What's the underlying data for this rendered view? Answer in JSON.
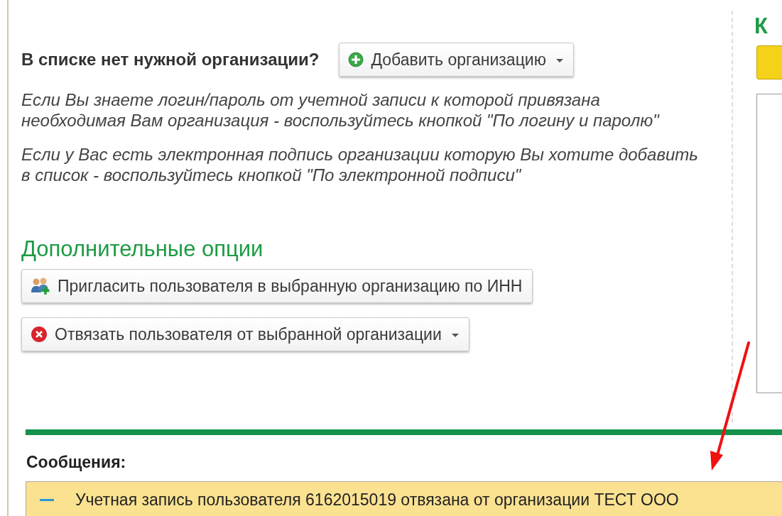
{
  "question_label": "В списке нет нужной организации?",
  "add_button": {
    "kind": "add",
    "label": "Добавить организацию",
    "dropdown": true
  },
  "hints": [
    "Если Вы знаете логин/пароль от учетной записи к которой привязана необходимая Вам организация - воспользуйтесь кнопкой \"По логину и паролю\"",
    "Если у Вас есть электронная подпись организации которую Вы хотите добавить в список - воспользуйтесь кнопкой \"По электронной подписи\""
  ],
  "options_heading": "Дополнительные опции",
  "option_buttons": [
    {
      "kind": "invite",
      "label": "Пригласить пользователя в выбранную организацию по ИНН",
      "dropdown": false
    },
    {
      "kind": "unlink",
      "label": "Отвязать пользователя от выбранной организации",
      "dropdown": true
    }
  ],
  "right_panel": {
    "heading": "К"
  },
  "messages": {
    "title": "Сообщения:",
    "items": [
      {
        "text": "Учетная запись пользователя 6162015019 отвязана от организации ТЕСТ ООО"
      }
    ]
  }
}
